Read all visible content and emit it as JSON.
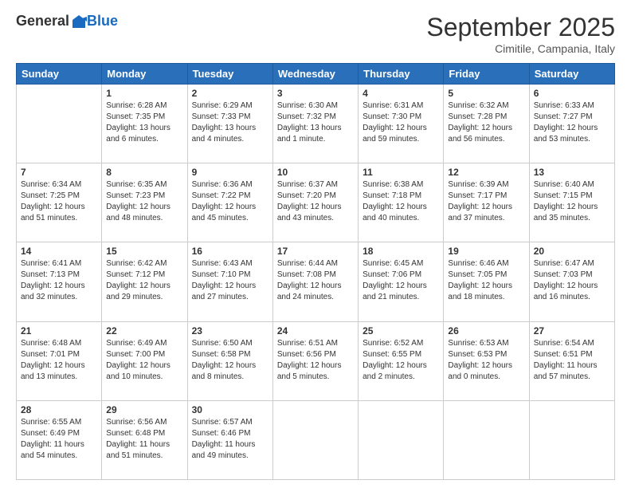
{
  "header": {
    "logo_general": "General",
    "logo_blue": "Blue",
    "month_title": "September 2025",
    "location": "Cimitile, Campania, Italy"
  },
  "weekdays": [
    "Sunday",
    "Monday",
    "Tuesday",
    "Wednesday",
    "Thursday",
    "Friday",
    "Saturday"
  ],
  "weeks": [
    [
      {
        "day": "",
        "info": ""
      },
      {
        "day": "1",
        "info": "Sunrise: 6:28 AM\nSunset: 7:35 PM\nDaylight: 13 hours\nand 6 minutes."
      },
      {
        "day": "2",
        "info": "Sunrise: 6:29 AM\nSunset: 7:33 PM\nDaylight: 13 hours\nand 4 minutes."
      },
      {
        "day": "3",
        "info": "Sunrise: 6:30 AM\nSunset: 7:32 PM\nDaylight: 13 hours\nand 1 minute."
      },
      {
        "day": "4",
        "info": "Sunrise: 6:31 AM\nSunset: 7:30 PM\nDaylight: 12 hours\nand 59 minutes."
      },
      {
        "day": "5",
        "info": "Sunrise: 6:32 AM\nSunset: 7:28 PM\nDaylight: 12 hours\nand 56 minutes."
      },
      {
        "day": "6",
        "info": "Sunrise: 6:33 AM\nSunset: 7:27 PM\nDaylight: 12 hours\nand 53 minutes."
      }
    ],
    [
      {
        "day": "7",
        "info": "Sunrise: 6:34 AM\nSunset: 7:25 PM\nDaylight: 12 hours\nand 51 minutes."
      },
      {
        "day": "8",
        "info": "Sunrise: 6:35 AM\nSunset: 7:23 PM\nDaylight: 12 hours\nand 48 minutes."
      },
      {
        "day": "9",
        "info": "Sunrise: 6:36 AM\nSunset: 7:22 PM\nDaylight: 12 hours\nand 45 minutes."
      },
      {
        "day": "10",
        "info": "Sunrise: 6:37 AM\nSunset: 7:20 PM\nDaylight: 12 hours\nand 43 minutes."
      },
      {
        "day": "11",
        "info": "Sunrise: 6:38 AM\nSunset: 7:18 PM\nDaylight: 12 hours\nand 40 minutes."
      },
      {
        "day": "12",
        "info": "Sunrise: 6:39 AM\nSunset: 7:17 PM\nDaylight: 12 hours\nand 37 minutes."
      },
      {
        "day": "13",
        "info": "Sunrise: 6:40 AM\nSunset: 7:15 PM\nDaylight: 12 hours\nand 35 minutes."
      }
    ],
    [
      {
        "day": "14",
        "info": "Sunrise: 6:41 AM\nSunset: 7:13 PM\nDaylight: 12 hours\nand 32 minutes."
      },
      {
        "day": "15",
        "info": "Sunrise: 6:42 AM\nSunset: 7:12 PM\nDaylight: 12 hours\nand 29 minutes."
      },
      {
        "day": "16",
        "info": "Sunrise: 6:43 AM\nSunset: 7:10 PM\nDaylight: 12 hours\nand 27 minutes."
      },
      {
        "day": "17",
        "info": "Sunrise: 6:44 AM\nSunset: 7:08 PM\nDaylight: 12 hours\nand 24 minutes."
      },
      {
        "day": "18",
        "info": "Sunrise: 6:45 AM\nSunset: 7:06 PM\nDaylight: 12 hours\nand 21 minutes."
      },
      {
        "day": "19",
        "info": "Sunrise: 6:46 AM\nSunset: 7:05 PM\nDaylight: 12 hours\nand 18 minutes."
      },
      {
        "day": "20",
        "info": "Sunrise: 6:47 AM\nSunset: 7:03 PM\nDaylight: 12 hours\nand 16 minutes."
      }
    ],
    [
      {
        "day": "21",
        "info": "Sunrise: 6:48 AM\nSunset: 7:01 PM\nDaylight: 12 hours\nand 13 minutes."
      },
      {
        "day": "22",
        "info": "Sunrise: 6:49 AM\nSunset: 7:00 PM\nDaylight: 12 hours\nand 10 minutes."
      },
      {
        "day": "23",
        "info": "Sunrise: 6:50 AM\nSunset: 6:58 PM\nDaylight: 12 hours\nand 8 minutes."
      },
      {
        "day": "24",
        "info": "Sunrise: 6:51 AM\nSunset: 6:56 PM\nDaylight: 12 hours\nand 5 minutes."
      },
      {
        "day": "25",
        "info": "Sunrise: 6:52 AM\nSunset: 6:55 PM\nDaylight: 12 hours\nand 2 minutes."
      },
      {
        "day": "26",
        "info": "Sunrise: 6:53 AM\nSunset: 6:53 PM\nDaylight: 12 hours\nand 0 minutes."
      },
      {
        "day": "27",
        "info": "Sunrise: 6:54 AM\nSunset: 6:51 PM\nDaylight: 11 hours\nand 57 minutes."
      }
    ],
    [
      {
        "day": "28",
        "info": "Sunrise: 6:55 AM\nSunset: 6:49 PM\nDaylight: 11 hours\nand 54 minutes."
      },
      {
        "day": "29",
        "info": "Sunrise: 6:56 AM\nSunset: 6:48 PM\nDaylight: 11 hours\nand 51 minutes."
      },
      {
        "day": "30",
        "info": "Sunrise: 6:57 AM\nSunset: 6:46 PM\nDaylight: 11 hours\nand 49 minutes."
      },
      {
        "day": "",
        "info": ""
      },
      {
        "day": "",
        "info": ""
      },
      {
        "day": "",
        "info": ""
      },
      {
        "day": "",
        "info": ""
      }
    ]
  ]
}
